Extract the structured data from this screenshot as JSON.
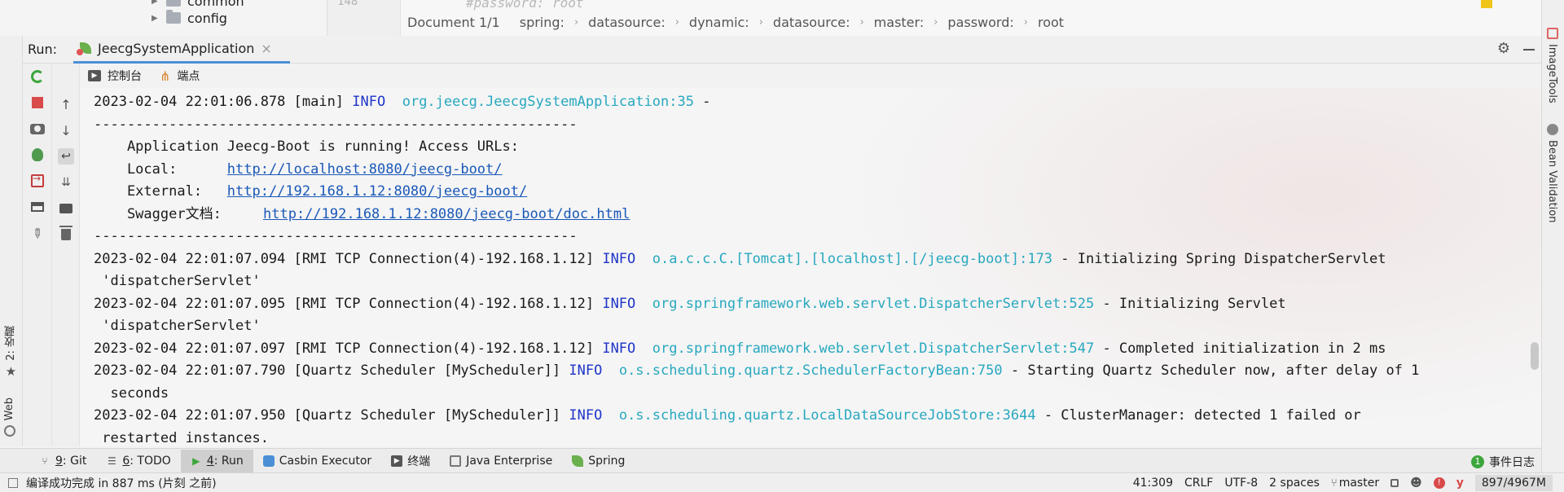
{
  "project_tree": {
    "items": [
      {
        "label": "common"
      },
      {
        "label": "config"
      }
    ]
  },
  "editor": {
    "gutter_line": "148",
    "ghost_code": "#password: root",
    "breadcrumb": {
      "doc": "Document 1/1",
      "items": [
        "spring:",
        "datasource:",
        "dynamic:",
        "datasource:",
        "master:",
        "password:",
        "root"
      ]
    }
  },
  "run_window": {
    "label": "Run:",
    "tab_label": "JeecgSystemApplication",
    "subtabs": [
      "控制台",
      "端点"
    ]
  },
  "console": {
    "lines": [
      {
        "parts": [
          {
            "t": "2023-02-04 22:01:06.878 [main] "
          },
          {
            "t": "INFO",
            "c": "lvl"
          },
          {
            "t": "  "
          },
          {
            "t": "org.jeecg.JeecgSystemApplication:35",
            "c": "logger"
          },
          {
            "t": " -"
          }
        ]
      },
      {
        "parts": [
          {
            "t": "----------------------------------------------------------"
          }
        ]
      },
      {
        "parts": [
          {
            "t": "    Application Jeecg-Boot is running! Access URLs:"
          }
        ]
      },
      {
        "parts": [
          {
            "t": "    Local:      "
          },
          {
            "t": "http://localhost:8080/jeecg-boot/",
            "c": "url"
          }
        ]
      },
      {
        "parts": [
          {
            "t": "    External:   "
          },
          {
            "t": "http://192.168.1.12:8080/jeecg-boot/",
            "c": "url"
          }
        ]
      },
      {
        "parts": [
          {
            "t": "    Swagger文档:     "
          },
          {
            "t": "http://192.168.1.12:8080/jeecg-boot/doc.html",
            "c": "url"
          }
        ]
      },
      {
        "parts": [
          {
            "t": "----------------------------------------------------------"
          }
        ]
      },
      {
        "parts": [
          {
            "t": "2023-02-04 22:01:07.094 [RMI TCP Connection(4)-192.168.1.12] "
          },
          {
            "t": "INFO",
            "c": "lvl"
          },
          {
            "t": "  "
          },
          {
            "t": "o.a.c.c.C.[Tomcat].[localhost].[/jeecg-boot]:173",
            "c": "logger"
          },
          {
            "t": " - Initializing Spring DispatcherServlet"
          }
        ]
      },
      {
        "parts": [
          {
            "t": " 'dispatcherServlet'"
          }
        ]
      },
      {
        "parts": [
          {
            "t": "2023-02-04 22:01:07.095 [RMI TCP Connection(4)-192.168.1.12] "
          },
          {
            "t": "INFO",
            "c": "lvl"
          },
          {
            "t": "  "
          },
          {
            "t": "org.springframework.web.servlet.DispatcherServlet:525",
            "c": "logger"
          },
          {
            "t": " - Initializing Servlet"
          }
        ]
      },
      {
        "parts": [
          {
            "t": " 'dispatcherServlet'"
          }
        ]
      },
      {
        "parts": [
          {
            "t": "2023-02-04 22:01:07.097 [RMI TCP Connection(4)-192.168.1.12] "
          },
          {
            "t": "INFO",
            "c": "lvl"
          },
          {
            "t": "  "
          },
          {
            "t": "org.springframework.web.servlet.DispatcherServlet:547",
            "c": "logger"
          },
          {
            "t": " - Completed initialization in 2 ms"
          }
        ]
      },
      {
        "parts": [
          {
            "t": "2023-02-04 22:01:07.790 [Quartz Scheduler [MyScheduler]] "
          },
          {
            "t": "INFO",
            "c": "lvl"
          },
          {
            "t": "  "
          },
          {
            "t": "o.s.scheduling.quartz.SchedulerFactoryBean:750",
            "c": "logger"
          },
          {
            "t": " - Starting Quartz Scheduler now, after delay of 1"
          }
        ]
      },
      {
        "parts": [
          {
            "t": "  seconds"
          }
        ]
      },
      {
        "parts": [
          {
            "t": "2023-02-04 22:01:07.950 [Quartz Scheduler [MyScheduler]] "
          },
          {
            "t": "INFO",
            "c": "lvl"
          },
          {
            "t": "  "
          },
          {
            "t": "o.s.scheduling.quartz.LocalDataSourceJobStore:3644",
            "c": "logger"
          },
          {
            "t": " - ClusterManager: detected 1 failed or"
          }
        ]
      },
      {
        "parts": [
          {
            "t": " restarted instances."
          }
        ]
      }
    ]
  },
  "left_strip": {
    "favorites_label": "2: 收藏",
    "web_label": "Web"
  },
  "right_strip": {
    "imagetools_label": "ImageTools",
    "bean_label": "Bean Validation"
  },
  "bottom_tabs": [
    {
      "num": "9",
      "label": ": Git"
    },
    {
      "num": "6",
      "label": ": TODO"
    },
    {
      "num": "4",
      "label": ": Run"
    },
    {
      "num": "",
      "label": "Casbin Executor"
    },
    {
      "num": "",
      "label": "终端"
    },
    {
      "num": "",
      "label": "Java Enterprise"
    },
    {
      "num": "",
      "label": "Spring"
    }
  ],
  "event_log": {
    "badge": "1",
    "label": "事件日志"
  },
  "status_bar": {
    "message": "编译成功完成 in 887 ms (片刻 之前)",
    "position": "41:309",
    "line_ending": "CRLF",
    "encoding": "UTF-8",
    "indent": "2 spaces",
    "branch": "master",
    "memory": "897/4967M"
  },
  "colors": {
    "log_level": "#1f35c8",
    "logger": "#27a8bf",
    "link": "#1a58b8",
    "active_tab_underline": "#4b8fd6"
  }
}
